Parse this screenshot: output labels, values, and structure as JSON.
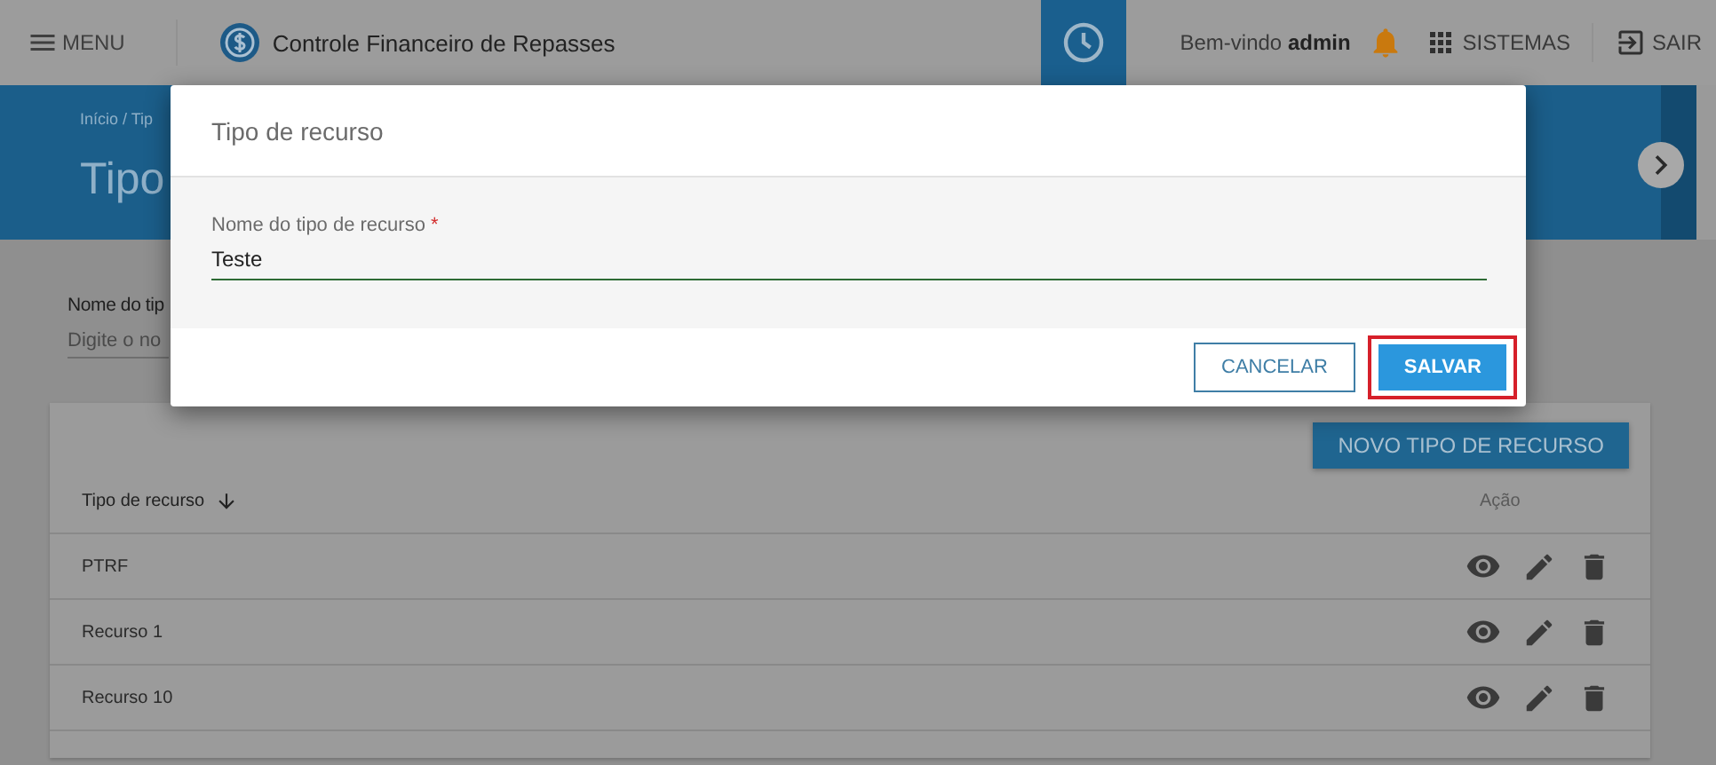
{
  "header": {
    "menu_label": "MENU",
    "app_title": "Controle Financeiro de Repasses",
    "welcome": "Bem-vindo **admin**",
    "systems_label": "SISTEMAS",
    "logout_label": "SAIR"
  },
  "banner": {
    "breadcrumb": "Início / Tip",
    "title": "Tipo"
  },
  "filter": {
    "label": "Nome do tip",
    "placeholder": "Digite o no"
  },
  "table": {
    "new_button": "NOVO TIPO DE RECURSO",
    "columns": [
      {
        "label": "Tipo de recurso",
        "sorted": true
      },
      {
        "label": "Ação",
        "sorted": false
      }
    ],
    "rows": [
      {
        "name": "PTRF"
      },
      {
        "name": "Recurso 1"
      },
      {
        "name": "Recurso 10"
      }
    ]
  },
  "dialog": {
    "title": "Tipo de recurso",
    "field": {
      "label": "Nome do tipo de recurso",
      "required_mark": "*",
      "value": "Teste"
    },
    "buttons": [
      {
        "label": "CANCELAR",
        "kind": "outline",
        "highlighted": false
      },
      {
        "label": "SALVAR",
        "kind": "primary",
        "highlighted": true
      }
    ]
  }
}
